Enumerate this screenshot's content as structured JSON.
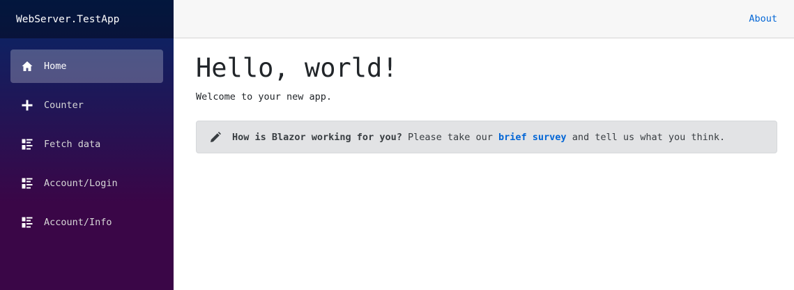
{
  "brand": {
    "title": "WebServer.TestApp"
  },
  "nav": {
    "items": [
      {
        "label": "Home",
        "icon": "home-icon",
        "active": true
      },
      {
        "label": "Counter",
        "icon": "plus-icon",
        "active": false
      },
      {
        "label": "Fetch data",
        "icon": "list-rich-icon",
        "active": false
      },
      {
        "label": "Account/Login",
        "icon": "list-rich-icon",
        "active": false
      },
      {
        "label": "Account/Info",
        "icon": "list-rich-icon",
        "active": false
      }
    ]
  },
  "top_row": {
    "about_label": "About"
  },
  "main": {
    "title": "Hello, world!",
    "welcome": "Welcome to your new app.",
    "survey": {
      "icon": "pencil-icon",
      "question": "How is Blazor working for you?",
      "text_before": " Please take our ",
      "link_label": "brief survey",
      "text_after": " and tell us what you think."
    }
  },
  "colors": {
    "sidebar_top": "#052767",
    "sidebar_bottom": "#3a0647",
    "link": "#0366d6",
    "alert_bg": "#e2e3e5"
  }
}
